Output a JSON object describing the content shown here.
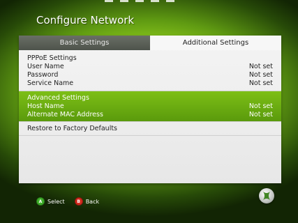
{
  "title": "Configure Network",
  "tabs": [
    {
      "label": "Basic Settings",
      "active": false
    },
    {
      "label": "Additional Settings",
      "active": true
    }
  ],
  "pppoe": {
    "heading": "PPPoE Settings",
    "rows": [
      {
        "label": "User Name",
        "value": "Not set"
      },
      {
        "label": "Password",
        "value": "Not set"
      },
      {
        "label": "Service Name",
        "value": "Not set"
      }
    ]
  },
  "advanced": {
    "heading": "Advanced Settings",
    "rows": [
      {
        "label": "Host Name",
        "value": "Not set"
      },
      {
        "label": "Alternate MAC Address",
        "value": "Not set"
      }
    ]
  },
  "restore_label": "Restore to Factory Defaults",
  "footer": {
    "a_glyph": "A",
    "a_label": "Select",
    "b_glyph": "B",
    "b_label": "Back"
  },
  "colors": {
    "accent_green": "#6aaa10",
    "button_a": "#3fae2a",
    "button_b": "#d22b1e"
  },
  "icons": [
    "xbox-logo-icon"
  ]
}
